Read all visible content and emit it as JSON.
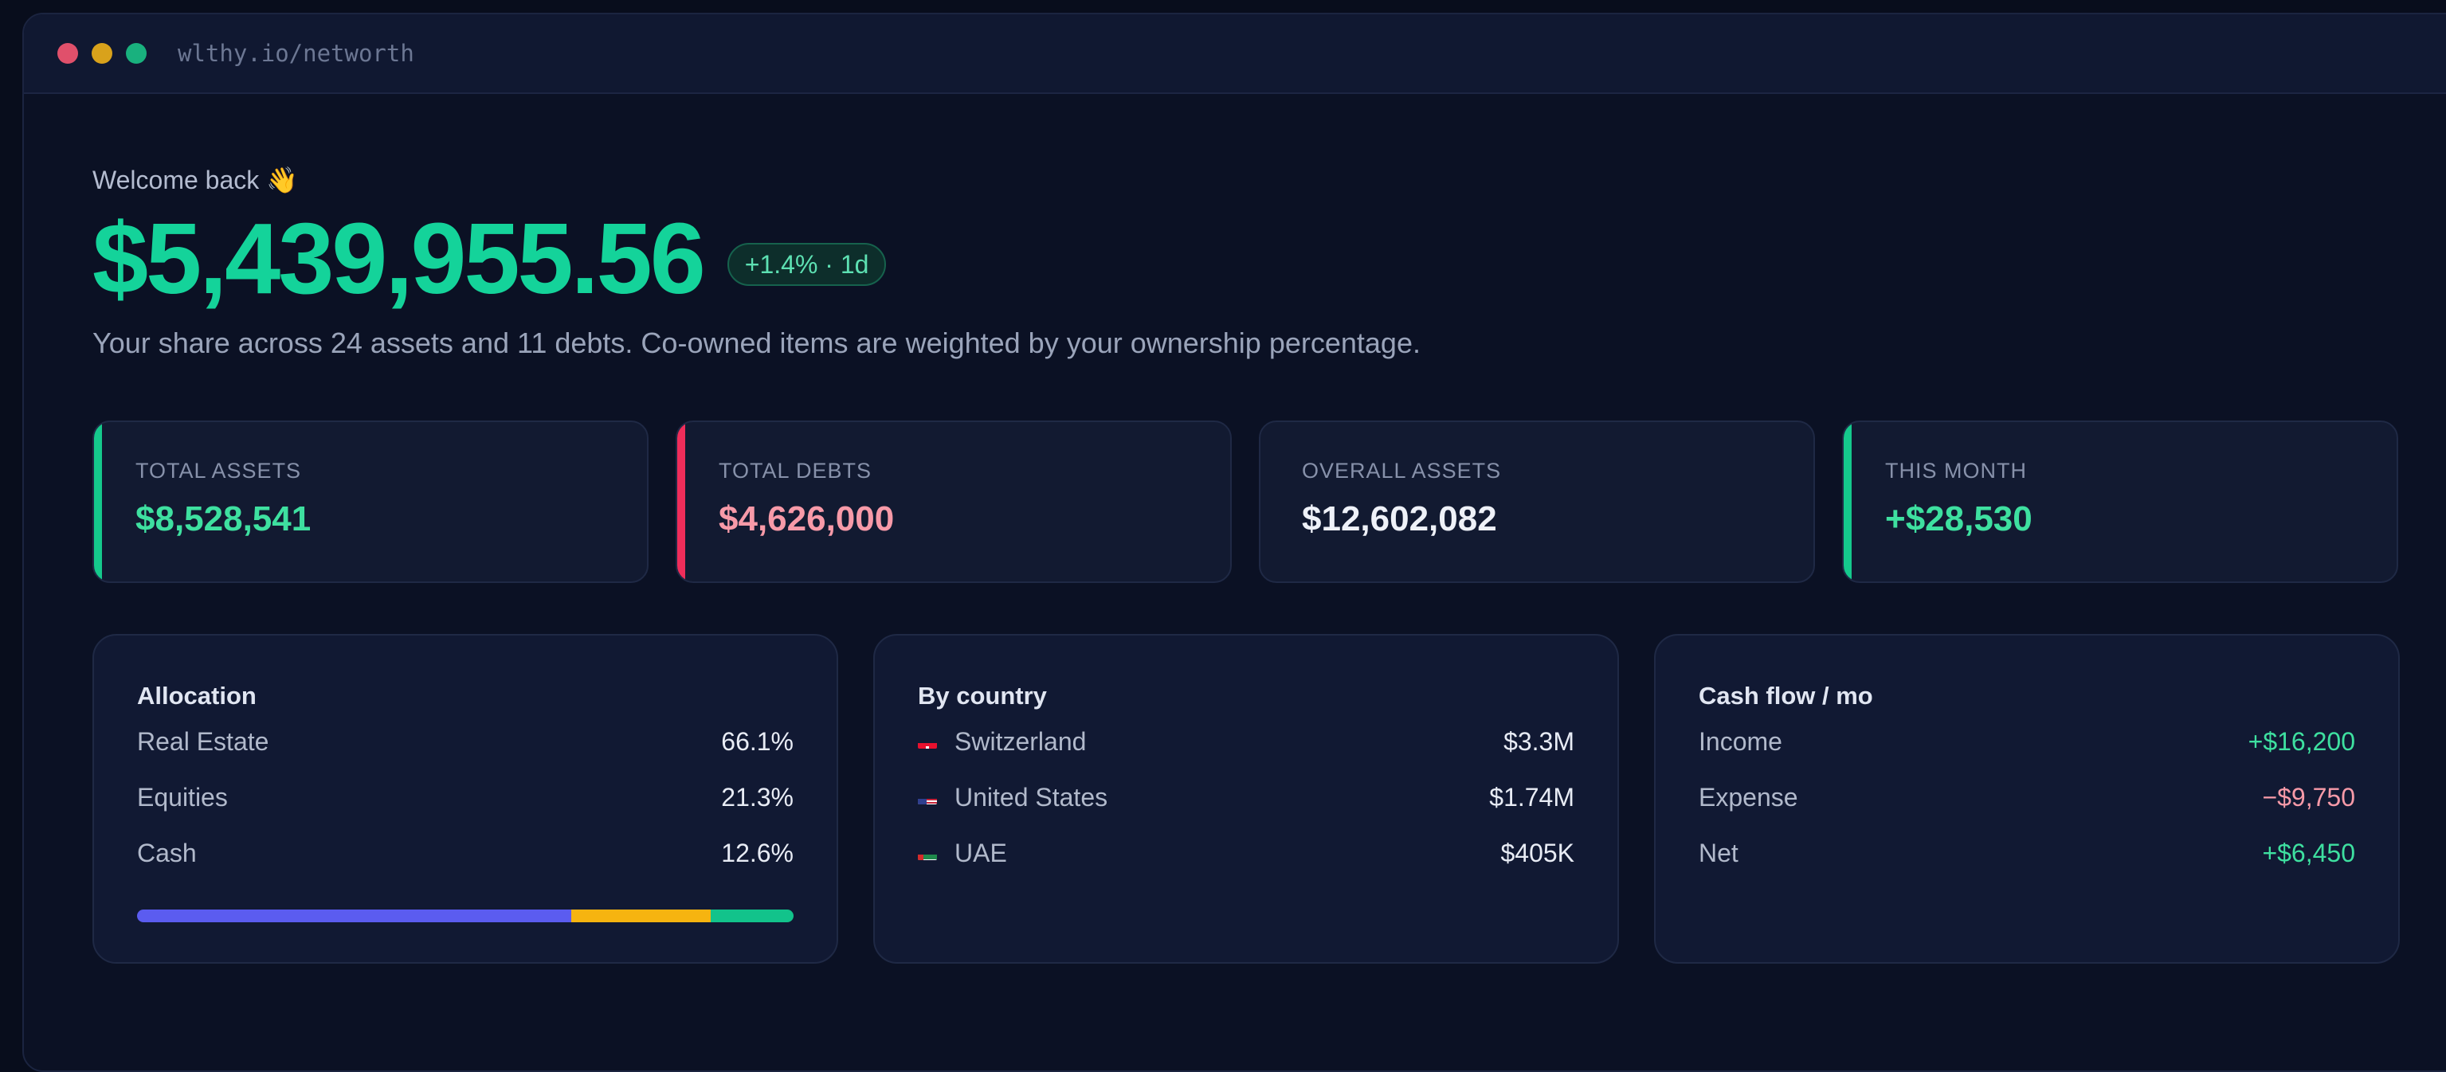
{
  "browser": {
    "url": "wlthy.io/networth"
  },
  "header": {
    "welcome": "Welcome back 👋",
    "net_worth": "$5,439,955.56",
    "change_badge": "+1.4% · 1d",
    "subtitle": "Your share across 24 assets and 11 debts. Co-owned items are weighted by your ownership percentage."
  },
  "stats": [
    {
      "label": "TOTAL ASSETS",
      "value": "$8,528,541",
      "color": "#3ee0a0",
      "accent": "#15c98c"
    },
    {
      "label": "TOTAL DEBTS",
      "value": "$4,626,000",
      "color": "#f79aa8",
      "accent": "#ef2d5a"
    },
    {
      "label": "OVERALL ASSETS",
      "value": "$12,602,082",
      "color": "#eef1f8",
      "accent": ""
    },
    {
      "label": "THIS MONTH",
      "value": "+$28,530",
      "color": "#3ee0a0",
      "accent": "#15c98c"
    }
  ],
  "allocation": {
    "title": "Allocation",
    "items": [
      {
        "label": "Real Estate",
        "value": "66.1%",
        "fraction": 0.661,
        "color": "#5b5cf0"
      },
      {
        "label": "Equities",
        "value": "21.3%",
        "fraction": 0.213,
        "color": "#f6b410"
      },
      {
        "label": "Cash",
        "value": "12.6%",
        "fraction": 0.126,
        "color": "#12c38b"
      }
    ]
  },
  "by_country": {
    "title": "By country",
    "items": [
      {
        "label": "Switzerland",
        "value": "$3.3M",
        "flag": "switzerland-flag-icon"
      },
      {
        "label": "United States",
        "value": "$1.74M",
        "flag": "us-flag-icon"
      },
      {
        "label": "UAE",
        "value": "$405K",
        "flag": "uae-flag-icon"
      }
    ]
  },
  "cash_flow": {
    "title": "Cash flow / mo",
    "items": [
      {
        "label": "Income",
        "value": "+$16,200",
        "color": "#3ee0a0"
      },
      {
        "label": "Expense",
        "value": "−$9,750",
        "color": "#f79aa8"
      },
      {
        "label": "Net",
        "value": "+$6,450",
        "color": "#3ee0a0"
      }
    ]
  }
}
